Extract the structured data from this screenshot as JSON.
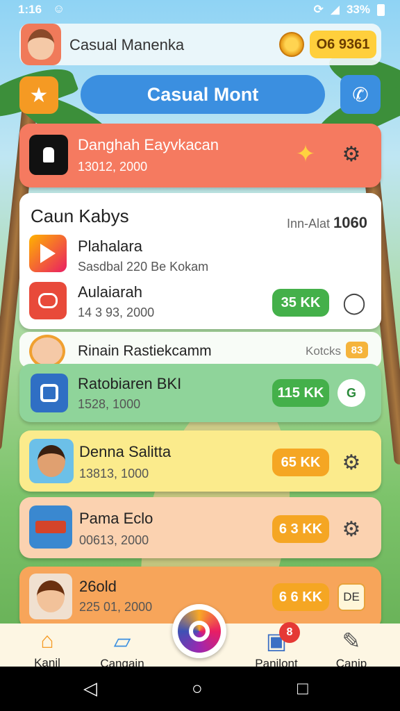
{
  "status_bar": {
    "time": "1:16",
    "battery": "33%"
  },
  "header": {
    "name": "Casual Manenka",
    "coins": "O6 9361"
  },
  "title": "Casual Mont",
  "featured": {
    "title": "Danghah Eayvkacan",
    "subtitle": "13012, 2000"
  },
  "list": {
    "heading": "Caun Kabys",
    "meta_label": "Inn-Alat",
    "meta_value": "1060",
    "items": [
      {
        "title": "Plahalara",
        "subtitle": "Sasdbal 220 Be Kokam"
      },
      {
        "title": "Aulaiarah",
        "subtitle": "14 3 93, 2000",
        "pill": "35 KK"
      }
    ]
  },
  "partial_row": {
    "title": "Rinain Rastiekcamm",
    "meta": "Kotcks",
    "tag": "83"
  },
  "cards": [
    {
      "title": "Ratobiaren BKI",
      "subtitle": "1528, 1000",
      "pill": "115 KK",
      "side": "G"
    },
    {
      "title": "Denna Salitta",
      "subtitle": "13813, 1000",
      "pill": "65 KK"
    },
    {
      "title": "Pama Eclo",
      "subtitle": "00613, 2000",
      "pill": "6 3 KK"
    },
    {
      "title": "26old",
      "subtitle": "225 01, 2000",
      "pill": "6 6 KK",
      "side": "DE"
    }
  ],
  "nav": {
    "items": [
      {
        "label": "Kanil"
      },
      {
        "label": "Cangain"
      },
      {
        "label": "Panilont",
        "badge": "8"
      },
      {
        "label": "Canip"
      }
    ]
  },
  "colors": {
    "accent_blue": "#3b8fe0",
    "featured": "#f57a60",
    "green": "#44b04a",
    "orange": "#f59a23"
  }
}
